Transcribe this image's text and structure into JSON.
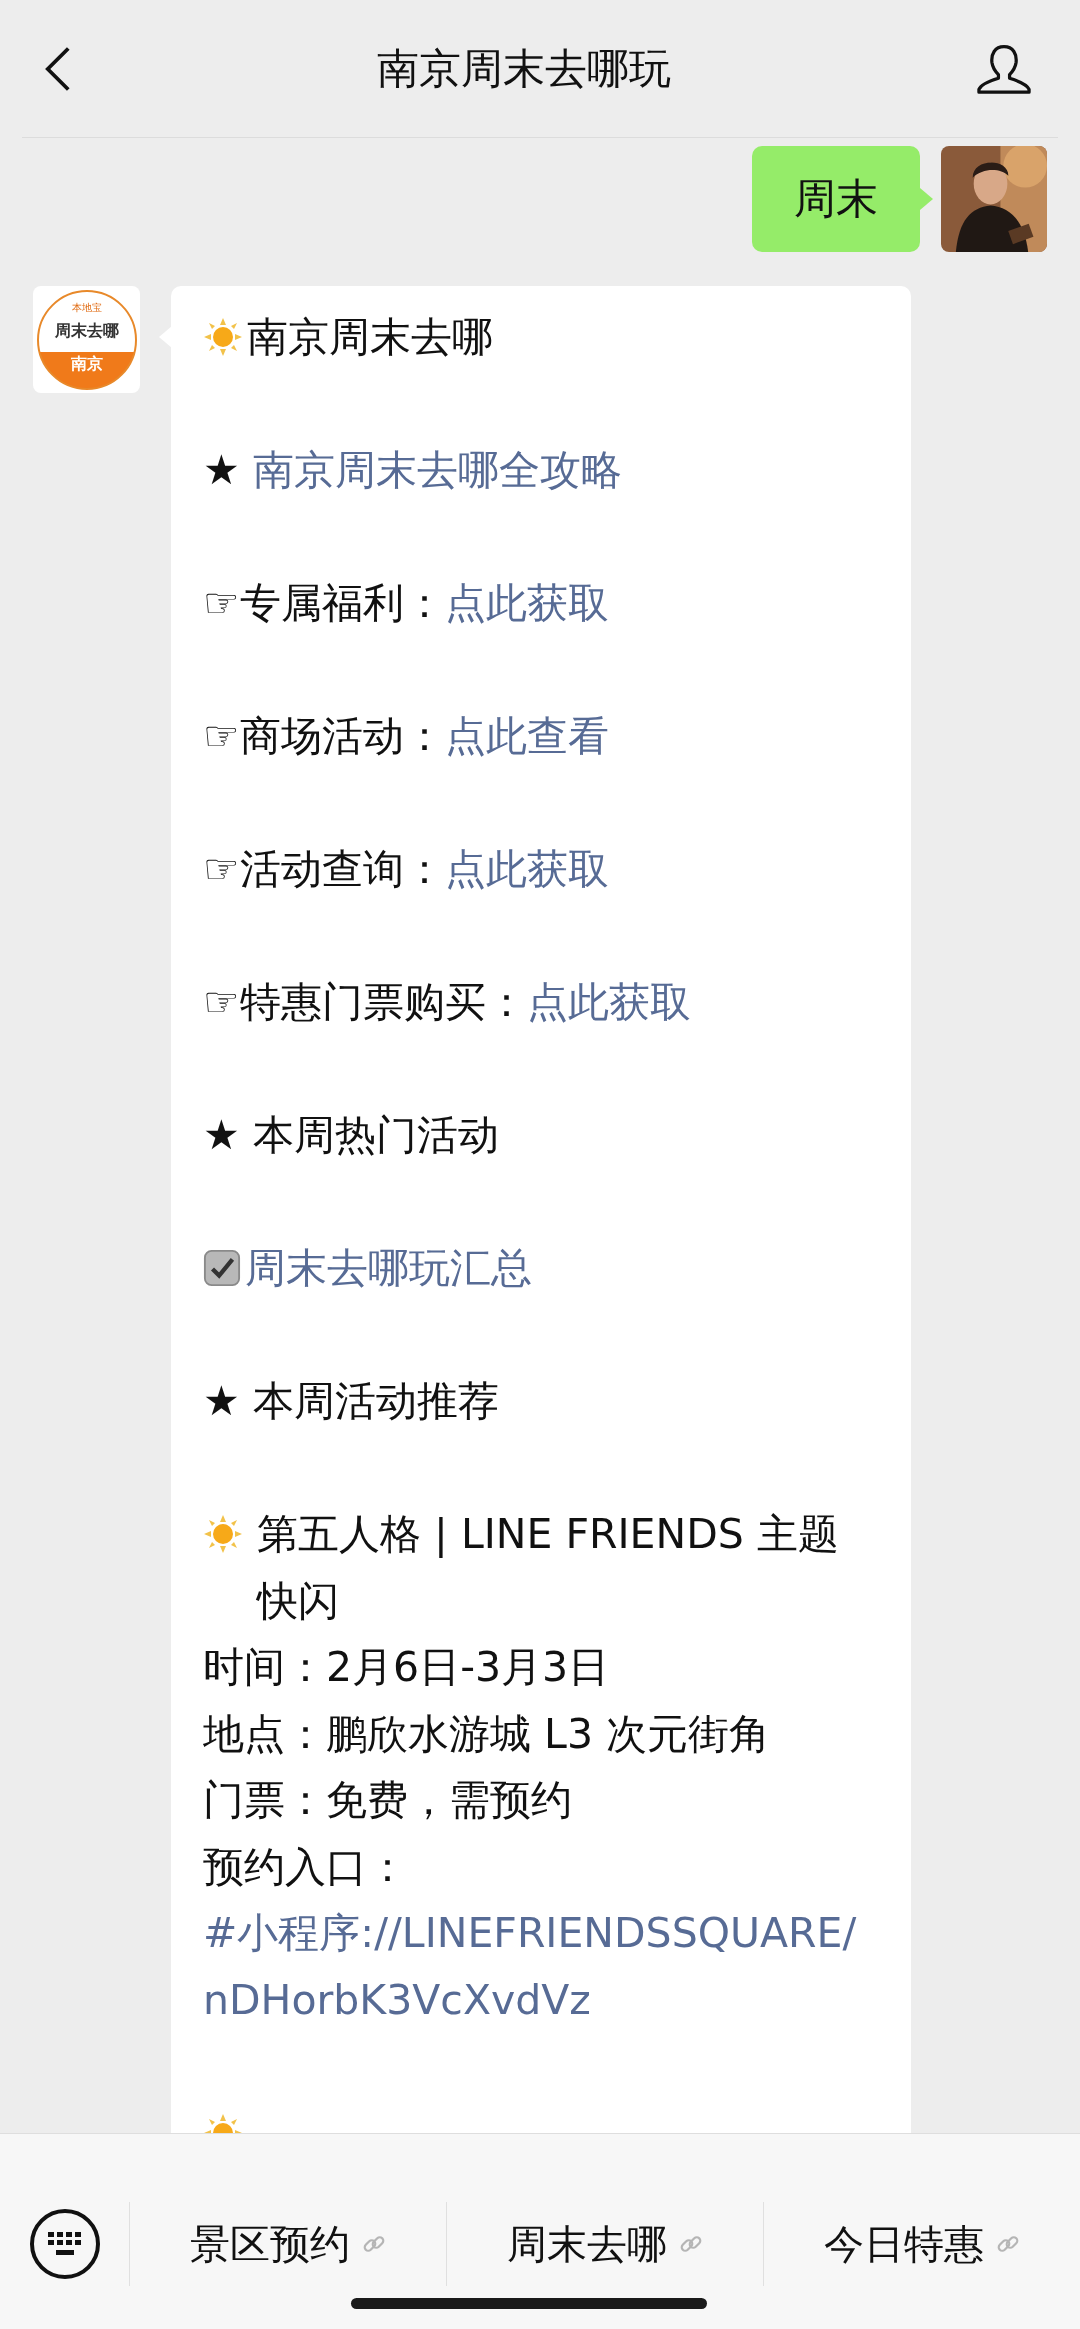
{
  "header": {
    "title": "南京周末去哪玩"
  },
  "messages": [
    {
      "kind": "sent",
      "text": "周末"
    },
    {
      "kind": "received",
      "logo": {
        "top": "本地宝",
        "middle": "周末去哪",
        "bottom": "南京"
      },
      "paragraphs": [
        {
          "kind": "sun",
          "segments": [
            {
              "text": "南京周末去哪",
              "link": false
            }
          ]
        },
        {
          "kind": "plain",
          "segments": [
            {
              "text": "★ ",
              "link": false
            },
            {
              "text": "南京周末去哪全攻略",
              "link": true
            }
          ]
        },
        {
          "kind": "plain",
          "segments": [
            {
              "text": "☞专属福利：",
              "link": false
            },
            {
              "text": "点此获取",
              "link": true
            }
          ]
        },
        {
          "kind": "plain",
          "segments": [
            {
              "text": "☞商场活动：",
              "link": false
            },
            {
              "text": "点此查看",
              "link": true
            }
          ]
        },
        {
          "kind": "plain",
          "segments": [
            {
              "text": "☞活动查询：",
              "link": false
            },
            {
              "text": "点此获取",
              "link": true
            }
          ]
        },
        {
          "kind": "plain",
          "segments": [
            {
              "text": "☞特惠门票购买：",
              "link": false
            },
            {
              "text": "点此获取",
              "link": true
            }
          ]
        },
        {
          "kind": "plain",
          "segments": [
            {
              "text": "★ 本周热门活动",
              "link": false
            }
          ]
        },
        {
          "kind": "check",
          "segments": [
            {
              "text": "周末去哪玩汇总",
              "link": true
            }
          ]
        },
        {
          "kind": "plain",
          "segments": [
            {
              "text": "★ 本周活动推荐",
              "link": false
            }
          ]
        }
      ],
      "event": {
        "title": "第五人格 | LINE FRIENDS 主题快闪",
        "lines": [
          "时间：2月6日-3月3日",
          "地点：鹏欣水游城 L3 次元街角",
          "门票：免费，需预约"
        ],
        "entry_label": "预约入口：",
        "entry_link": "#小程序://LINEFRIENDSSQUARE/nDHorbK3VcXvdVz"
      }
    }
  ],
  "menu_bar": {
    "items": [
      {
        "label": "景区预约"
      },
      {
        "label": "周末去哪"
      },
      {
        "label": "今日特惠"
      }
    ]
  }
}
